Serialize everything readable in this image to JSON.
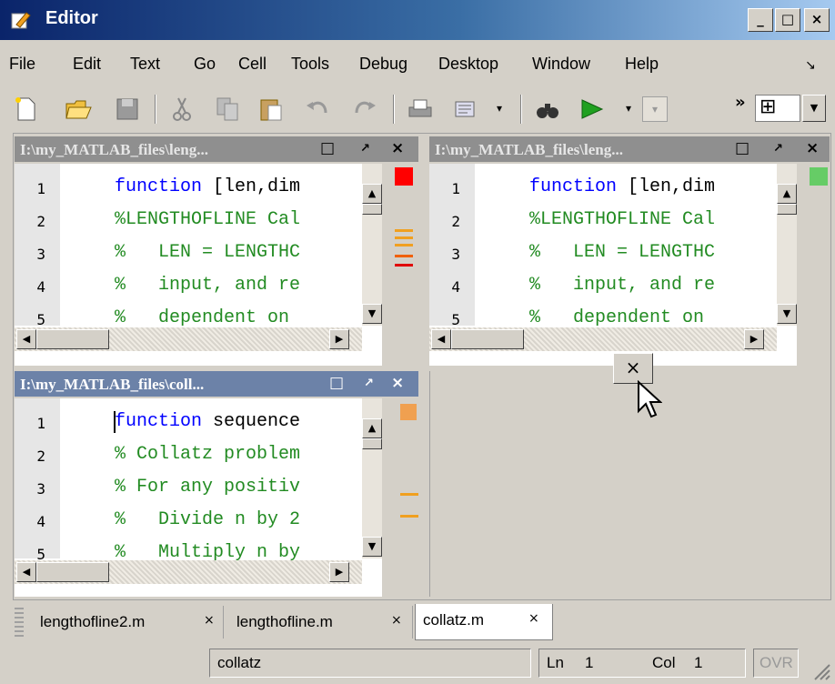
{
  "window": {
    "title": "Editor",
    "buttons": [
      "_",
      "□",
      "×"
    ]
  },
  "menu": [
    "File",
    "Edit",
    "Text",
    "Go",
    "Cell",
    "Tools",
    "Debug",
    "Desktop",
    "Window",
    "Help"
  ],
  "menu_overflow": "↘",
  "toolbar": {
    "icons": [
      "new-file-icon",
      "open-folder-icon",
      "save-icon",
      "cut-icon",
      "copy-icon",
      "paste-icon",
      "undo-icon",
      "redo-icon",
      "print-icon",
      "comment-icon",
      "find-icon",
      "run-icon",
      "breakpoint-dropdown",
      "layout-grid-icon"
    ],
    "overflow": "»",
    "layout_glyph": "⊞"
  },
  "panes": [
    {
      "title": "I:\\my_MATLAB_files\\leng...",
      "active": false,
      "status_color": "#ff0000",
      "lines": [
        {
          "n": "1",
          "segments": [
            {
              "t": "function",
              "c": "kw"
            },
            {
              "t": " [len,dim",
              "c": "tx"
            }
          ]
        },
        {
          "n": "2",
          "segments": [
            {
              "t": "%LENGTHOFLINE Cal",
              "c": "cm"
            }
          ]
        },
        {
          "n": "3",
          "segments": [
            {
              "t": "%   LEN = LENGTHC",
              "c": "cm"
            }
          ]
        },
        {
          "n": "4",
          "segments": [
            {
              "t": "%   input, and re",
              "c": "cm"
            }
          ]
        },
        {
          "n": "5",
          "segments": [
            {
              "t": "%   dependent on ",
              "c": "cm"
            }
          ]
        }
      ]
    },
    {
      "title": "I:\\my_MATLAB_files\\leng...",
      "active": false,
      "status_color": "#66cc66",
      "lines": [
        {
          "n": "1",
          "segments": [
            {
              "t": "function",
              "c": "kw"
            },
            {
              "t": " [len,dim",
              "c": "tx"
            }
          ]
        },
        {
          "n": "2",
          "segments": [
            {
              "t": "%LENGTHOFLINE Cal",
              "c": "cm"
            }
          ]
        },
        {
          "n": "3",
          "segments": [
            {
              "t": "%   LEN = LENGTHC",
              "c": "cm"
            }
          ]
        },
        {
          "n": "4",
          "segments": [
            {
              "t": "%   input, and re",
              "c": "cm"
            }
          ]
        },
        {
          "n": "5",
          "segments": [
            {
              "t": "%   dependent on ",
              "c": "cm"
            }
          ]
        }
      ]
    },
    {
      "title": "I:\\my_MATLAB_files\\coll...",
      "active": true,
      "status_color": "#f0a050",
      "lines": [
        {
          "n": "1",
          "segments": [
            {
              "t": "function",
              "c": "kw"
            },
            {
              "t": " sequence",
              "c": "tx"
            }
          ]
        },
        {
          "n": "2",
          "segments": [
            {
              "t": "% Collatz problem",
              "c": "cm"
            }
          ]
        },
        {
          "n": "3",
          "segments": [
            {
              "t": "% For any positiv",
              "c": "cm"
            }
          ]
        },
        {
          "n": "4",
          "segments": [
            {
              "t": "%   Divide n by 2",
              "c": "cm"
            }
          ]
        },
        {
          "n": "5",
          "segments": [
            {
              "t": "%   Multiply n by",
              "c": "cm"
            }
          ]
        }
      ]
    }
  ],
  "pane_buttons": {
    "maximize": "□",
    "undock": "↗",
    "close": "×"
  },
  "empty_pane_close": "×",
  "tabs": [
    {
      "label": "lengthofline2.m",
      "close": "×",
      "selected": false
    },
    {
      "label": "lengthofline.m",
      "close": "×",
      "selected": false
    },
    {
      "label": "collatz.m",
      "close": "×",
      "selected": true
    }
  ],
  "status": {
    "function": "collatz",
    "ln_label": "Ln",
    "ln": "1",
    "col_label": "Col",
    "col": "1",
    "mode": "OVR"
  },
  "colors": {
    "titlebar": "#0a246a",
    "keyword": "#0000ff",
    "comment": "#228b22",
    "active_pane": "#6c82a8",
    "inactive_pane": "#8f8f8f"
  }
}
